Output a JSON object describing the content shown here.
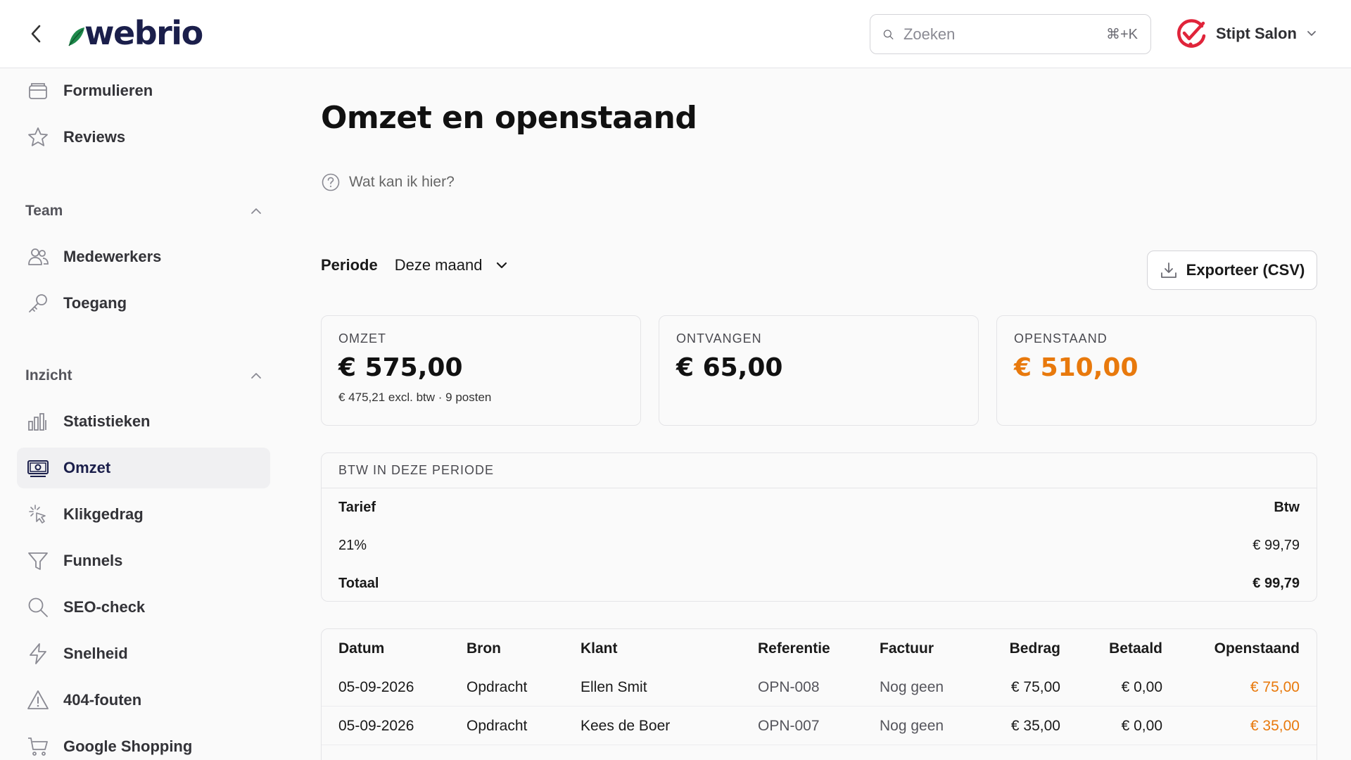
{
  "header": {
    "brand": "webrio",
    "search_placeholder": "Zoeken",
    "search_shortcut": "⌘+K",
    "account_name": "Stipt Salon"
  },
  "sidebar": {
    "top_items": [
      {
        "label": "Formulieren",
        "icon": "form-icon"
      },
      {
        "label": "Reviews",
        "icon": "star-icon"
      }
    ],
    "team": {
      "title": "Team",
      "items": [
        {
          "label": "Medewerkers",
          "icon": "users-icon"
        },
        {
          "label": "Toegang",
          "icon": "key-icon"
        }
      ]
    },
    "inzicht": {
      "title": "Inzicht",
      "items": [
        {
          "label": "Statistieken",
          "icon": "bar-chart-icon"
        },
        {
          "label": "Omzet",
          "icon": "money-icon",
          "active": true
        },
        {
          "label": "Klikgedrag",
          "icon": "click-icon"
        },
        {
          "label": "Funnels",
          "icon": "funnel-icon"
        },
        {
          "label": "SEO-check",
          "icon": "search-icon"
        },
        {
          "label": "Snelheid",
          "icon": "lightning-icon"
        },
        {
          "label": "404-fouten",
          "icon": "warning-icon"
        },
        {
          "label": "Google Shopping",
          "icon": "cart-icon"
        }
      ]
    }
  },
  "main": {
    "title": "Omzet en openstaand",
    "help_text": "Wat kan ik hier?",
    "period_label": "Periode",
    "period_value": "Deze maand",
    "export_label": "Exporteer (CSV)",
    "cards": [
      {
        "label": "OMZET",
        "value": "€ 575,00",
        "sub": "€ 475,21 excl. btw · 9 posten"
      },
      {
        "label": "ONTVANGEN",
        "value": "€ 65,00"
      },
      {
        "label": "OPENSTAAND",
        "value": "€ 510,00"
      }
    ],
    "vat": {
      "title": "BTW IN DEZE PERIODE",
      "col_rate": "Tarief",
      "col_vat": "Btw",
      "rows": [
        {
          "rate": "21%",
          "vat": "€ 99,79"
        }
      ],
      "total_label": "Totaal",
      "total_value": "€ 99,79"
    },
    "transactions": {
      "columns": [
        "Datum",
        "Bron",
        "Klant",
        "Referentie",
        "Factuur",
        "Bedrag",
        "Betaald",
        "Openstaand"
      ],
      "rows": [
        [
          "05-09-2026",
          "Opdracht",
          "Ellen Smit",
          "OPN-008",
          "Nog geen",
          "€ 75,00",
          "€ 0,00",
          "€ 75,00"
        ],
        [
          "05-09-2026",
          "Opdracht",
          "Kees de Boer",
          "OPN-007",
          "Nog geen",
          "€ 35,00",
          "€ 0,00",
          "€ 35,00"
        ]
      ]
    }
  },
  "colors": {
    "brand_navy": "#1b1f4b",
    "brand_green": "#1f8a4c",
    "accent_orange": "#e8790c",
    "account_red": "#e0243a"
  }
}
